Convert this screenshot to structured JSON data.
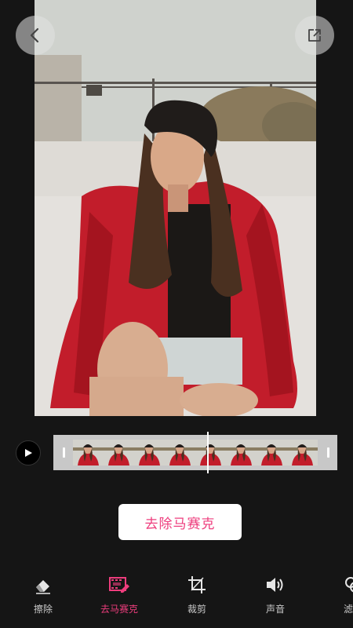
{
  "preview": {
    "image": "woman-red-jacket-photo"
  },
  "header": {
    "back_icon": "chevron-left-icon",
    "share_icon": "share-export-icon"
  },
  "timeline": {
    "play_icon": "play-icon",
    "playhead_position": 0.55,
    "frame_count": 8
  },
  "action": {
    "label": "去除马赛克"
  },
  "toolbar": {
    "items": [
      {
        "label": "擦除",
        "icon": "eraser-icon",
        "active": false
      },
      {
        "label": "去马赛克",
        "icon": "mosaic-film-icon",
        "active": true
      },
      {
        "label": "裁剪",
        "icon": "crop-icon",
        "active": false
      },
      {
        "label": "声音",
        "icon": "speaker-icon",
        "active": false
      },
      {
        "label": "滤",
        "icon": "filter-icon",
        "active": false
      }
    ]
  },
  "colors": {
    "background": "#151515",
    "accent": "#ee3d7d",
    "button_bg": "#ffffff"
  }
}
